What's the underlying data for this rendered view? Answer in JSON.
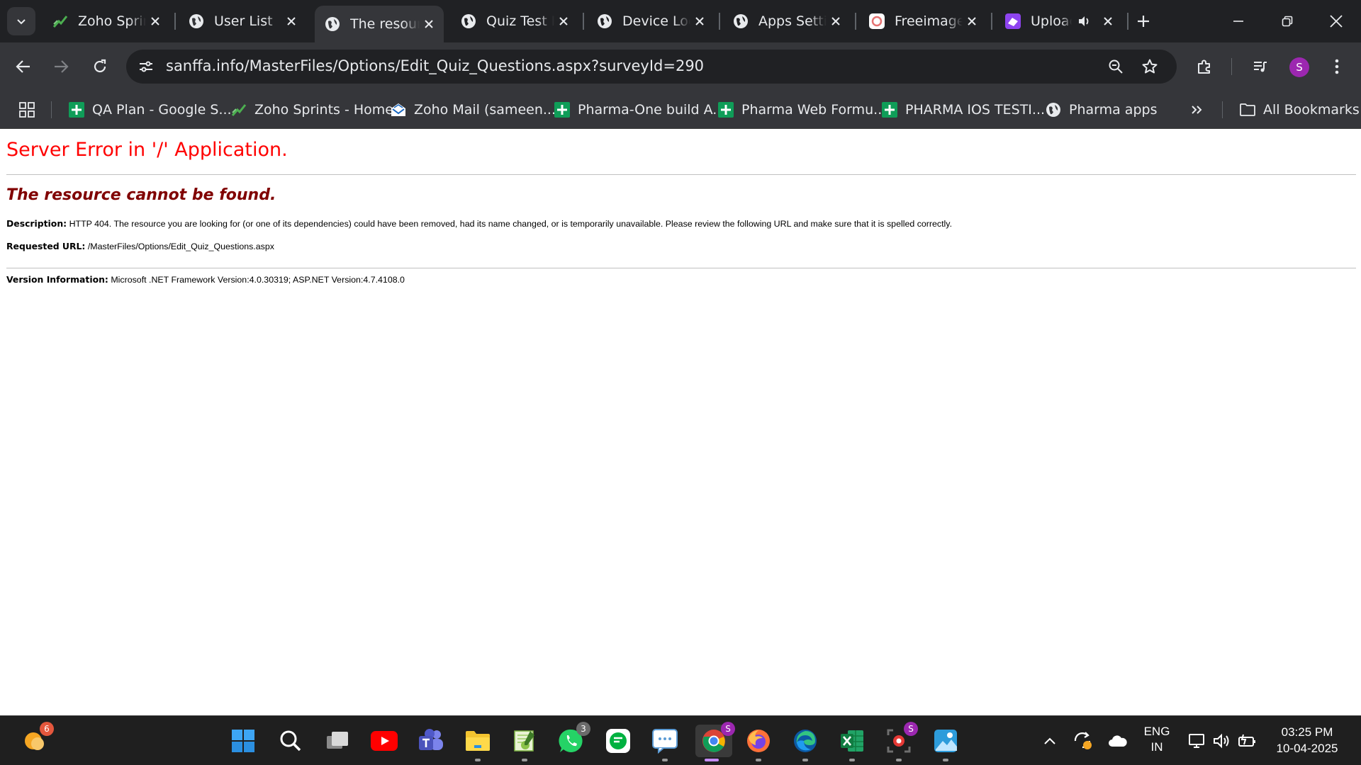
{
  "browser": {
    "tabs": [
      {
        "title": "Zoho Sprin",
        "icon": "zoho-sprints-icon",
        "active": false
      },
      {
        "title": "User List",
        "icon": "globe-icon",
        "active": false
      },
      {
        "title": "The resour",
        "icon": "globe-icon",
        "active": true
      },
      {
        "title": "Quiz Test F",
        "icon": "globe-icon",
        "active": false
      },
      {
        "title": "Device Loc",
        "icon": "globe-icon",
        "active": false
      },
      {
        "title": "Apps Settin",
        "icon": "globe-icon",
        "active": false
      },
      {
        "title": "Freeimage",
        "icon": "freeimage-icon",
        "active": false
      },
      {
        "title": "Uploac",
        "icon": "upload-site-icon",
        "active": false,
        "audio": true
      }
    ],
    "address_bar": {
      "url": "sanffa.info/MasterFiles/Options/Edit_Quiz_Questions.aspx?surveyId=290"
    },
    "profile_initial": "S",
    "bookmarks": [
      {
        "label": "QA Plan - Google S...",
        "icon": "google-sheets-icon"
      },
      {
        "label": "Zoho Sprints - Home",
        "icon": "zoho-sprints-icon"
      },
      {
        "label": "Zoho Mail (sameen...",
        "icon": "zoho-mail-icon"
      },
      {
        "label": "Pharma-One build A...",
        "icon": "google-sheets-icon"
      },
      {
        "label": "Pharma Web Formu...",
        "icon": "google-sheets-icon"
      },
      {
        "label": "PHARMA IOS TESTI...",
        "icon": "google-sheets-icon"
      },
      {
        "label": "Pharma apps",
        "icon": "globe-icon"
      }
    ],
    "all_bookmarks_label": "All Bookmarks"
  },
  "page": {
    "heading": "Server Error in '/' Application.",
    "subheading": "The resource cannot be found.",
    "description_label": "Description:",
    "description_text": "HTTP 404. The resource you are looking for (or one of its dependencies) could have been removed, had its name changed, or is temporarily unavailable.  Please review the following URL and make sure that it is spelled correctly.",
    "requested_url_label": "Requested URL:",
    "requested_url_value": "/MasterFiles/Options/Edit_Quiz_Questions.aspx",
    "version_label": "Version Information:",
    "version_text": "Microsoft .NET Framework Version:4.0.30319; ASP.NET Version:4.7.4108.0"
  },
  "taskbar": {
    "weather_badge": "6",
    "whatsapp_badge": "3",
    "chrome_profile_badge": "S",
    "recorder_profile_badge": "S",
    "language_line1": "ENG",
    "language_line2": "IN",
    "time": "03:25 PM",
    "date": "10-04-2025",
    "apps": [
      "start-icon",
      "search-icon",
      "task-view-icon",
      "youtube-icon",
      "teams-icon",
      "file-explorer-icon",
      "notepad-plus-icon",
      "whatsapp-icon",
      "chat-app-icon",
      "messages-icon",
      "chrome-icon",
      "firefox-icon",
      "edge-icon",
      "excel-icon",
      "screen-recorder-icon",
      "photos-icon"
    ]
  },
  "colors": {
    "error_heading": "#ff0000",
    "error_subheading": "#800000",
    "chrome_dark": "#202124",
    "chrome_toolbar": "#35363a"
  }
}
